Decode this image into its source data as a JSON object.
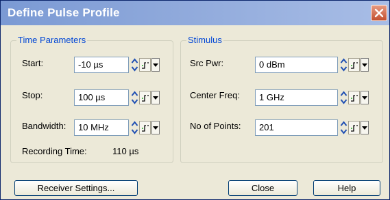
{
  "window": {
    "title": "Define Pulse Profile"
  },
  "time_parameters": {
    "legend": "Time Parameters",
    "start": {
      "label": "Start:",
      "value": "-10 µs"
    },
    "stop": {
      "label": "Stop:",
      "value": "100 µs"
    },
    "bandwidth": {
      "label": "Bandwidth:",
      "value": "10 MHz"
    },
    "recording_time": {
      "label": "Recording Time:",
      "value": "110 µs"
    }
  },
  "stimulus": {
    "legend": "Stimulus",
    "src_pwr": {
      "label": "Src Pwr:",
      "value": "0 dBm"
    },
    "center_freq": {
      "label": "Center Freq:",
      "value": "1 GHz"
    },
    "num_points": {
      "label": "No of Points:",
      "value": "201"
    }
  },
  "buttons": {
    "receiver_settings": "Receiver Settings...",
    "close": "Close",
    "help": "Help"
  },
  "icons": {
    "spin": "spin-arrows-icon",
    "step": "step-size-icon",
    "dropdown": "dropdown-arrow-icon",
    "close": "close-icon"
  },
  "colors": {
    "title_gradient_start": "#7b9ad4",
    "group_legend": "#0046d5",
    "close_button": "#c24f2f"
  }
}
